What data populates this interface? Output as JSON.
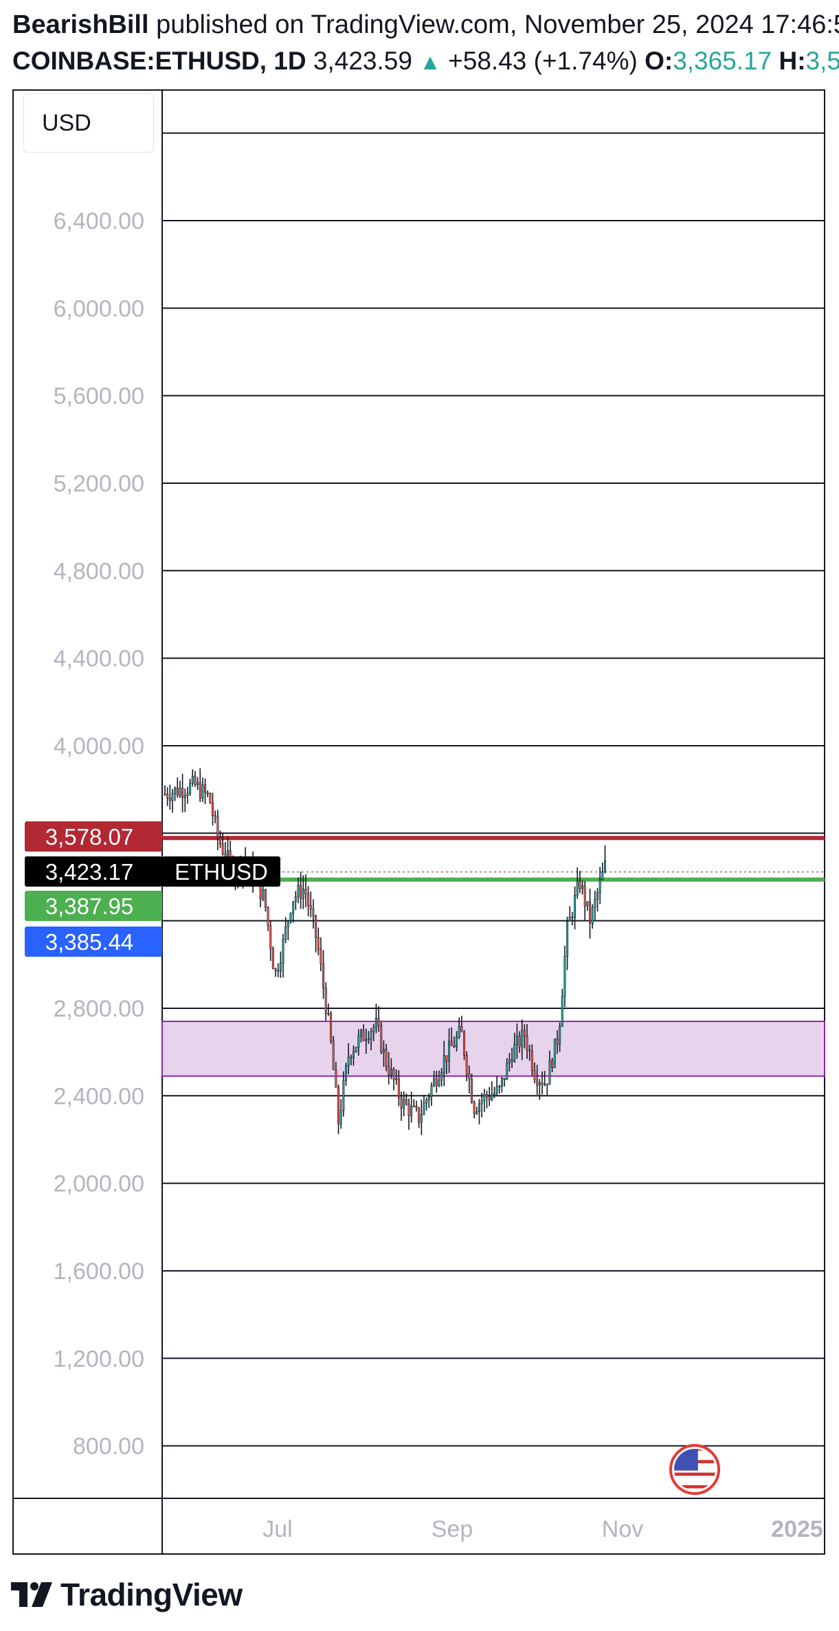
{
  "header": {
    "author": "BearishBill",
    "published_text": " published on TradingView.com, November 25, 2024 17:46:5",
    "symbol": "COINBASE:ETHUSD, 1D",
    "last": "3,423.59",
    "change": "+58.43 (+1.74%)",
    "open_label": "O:",
    "open_value": "3,365.17",
    "high_label": "H:",
    "high_value": "3,5"
  },
  "currency_button": "USD",
  "brand": "TradingView",
  "colors": {
    "up": "#26a69a",
    "candle_up": "#26a69a",
    "candle_down": "#ef5350",
    "resistance_line": "#b22833",
    "support_line": "#4caf50",
    "zone_fill": "#e8d3ec",
    "zone_border": "#8e24aa"
  },
  "icons": {
    "flag": "us-flag-icon",
    "logo": "tradingview-logo-icon"
  },
  "chart_data": {
    "type": "candlestick",
    "symbol": "ETHUSD",
    "ylim": [
      560,
      7000
    ],
    "y_ticks": [
      6400,
      6000,
      5600,
      5200,
      4800,
      4400,
      4000,
      2800,
      2400,
      2000,
      1600,
      1200,
      800
    ],
    "y_tick_labels": [
      "6,400.00",
      "6,000.00",
      "5,600.00",
      "5,200.00",
      "4,800.00",
      "4,400.00",
      "4,000.00",
      "2,800.00",
      "2,400.00",
      "2,000.00",
      "1,600.00",
      "1,200.00",
      "800.00"
    ],
    "x_labels": [
      "Jul",
      "Sep",
      "Nov",
      "2025"
    ],
    "price_labels": [
      {
        "text": "3,578.07",
        "value": 3578.07,
        "color": "#b22833"
      },
      {
        "text": "3,423.17",
        "value": 3423.17,
        "color": "#000000",
        "tag": "ETHUSD"
      },
      {
        "text": "3,387.95",
        "value": 3387.95,
        "color": "#4caf50"
      },
      {
        "text": "3,385.44",
        "value": 3385.44,
        "color": "#2962ff"
      }
    ],
    "horizontal_lines": [
      {
        "value": 3578.07,
        "color": "#b22833"
      },
      {
        "value": 3387.95,
        "color": "#4caf50"
      }
    ],
    "zone": {
      "from": 2490,
      "to": 2740
    },
    "candles_from": "2024-06-03",
    "candles_to": "2024-11-25",
    "close_path": [
      [
        0,
        3780
      ],
      [
        7,
        3800
      ],
      [
        14,
        3820
      ],
      [
        21,
        3760
      ],
      [
        25,
        3580
      ],
      [
        32,
        3430
      ],
      [
        38,
        3480
      ],
      [
        43,
        3380
      ],
      [
        47,
        3300
      ],
      [
        52,
        2950
      ],
      [
        56,
        3100
      ],
      [
        60,
        3300
      ],
      [
        66,
        3350
      ],
      [
        72,
        3100
      ],
      [
        78,
        2680
      ],
      [
        82,
        2280
      ],
      [
        87,
        2600
      ],
      [
        96,
        2700
      ],
      [
        100,
        2720
      ],
      [
        104,
        2570
      ],
      [
        112,
        2370
      ],
      [
        120,
        2300
      ],
      [
        126,
        2440
      ],
      [
        132,
        2570
      ],
      [
        140,
        2690
      ],
      [
        146,
        2350
      ],
      [
        152,
        2400
      ],
      [
        158,
        2420
      ],
      [
        164,
        2600
      ],
      [
        170,
        2680
      ],
      [
        175,
        2500
      ],
      [
        180,
        2460
      ],
      [
        186,
        2680
      ],
      [
        190,
        3150
      ],
      [
        196,
        3380
      ],
      [
        201,
        3200
      ],
      [
        208,
        3450
      ]
    ]
  }
}
